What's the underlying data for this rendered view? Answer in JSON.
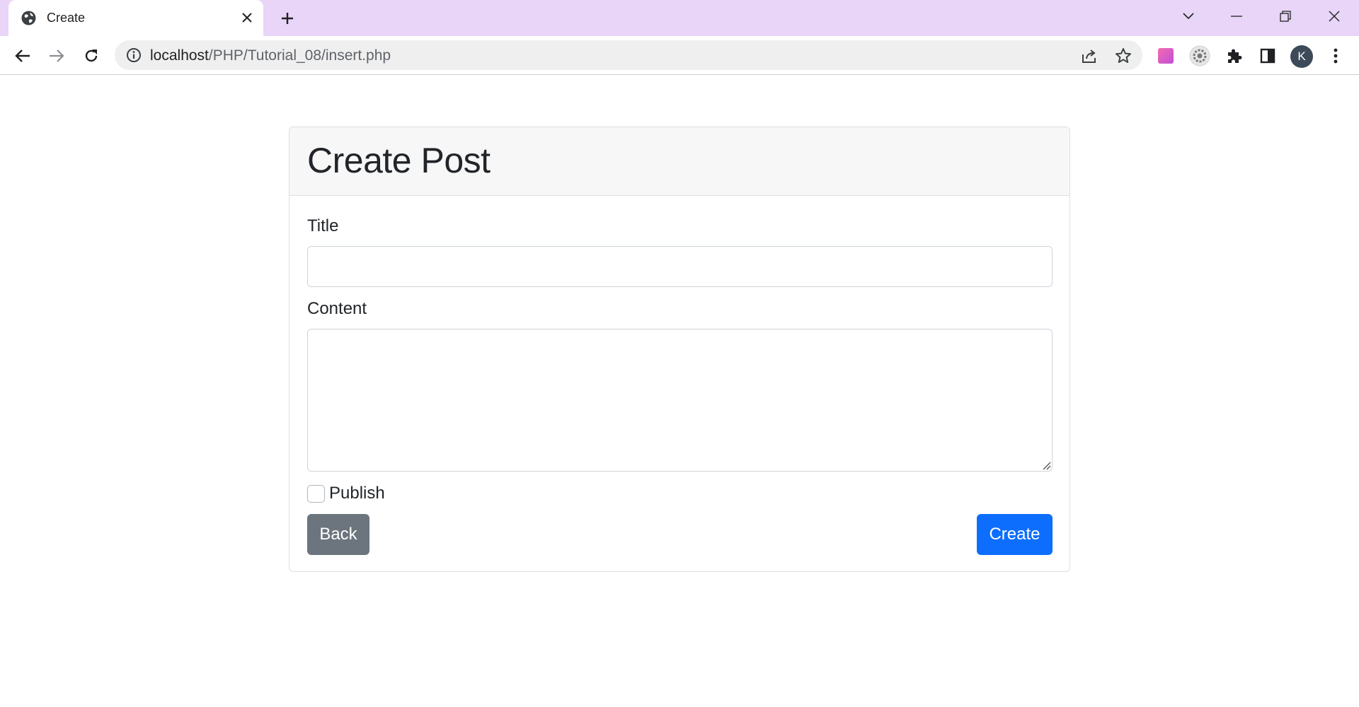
{
  "browser": {
    "tab_title": "Create",
    "url_host": "localhost",
    "url_path": "/PHP/Tutorial_08/insert.php",
    "profile_initial": "K",
    "icons": [
      "globe-icon",
      "close-icon",
      "plus-icon",
      "chevron-down-icon",
      "minimize-icon",
      "restore-icon",
      "window-close-icon",
      "back-arrow-icon",
      "forward-arrow-icon",
      "reload-icon",
      "info-icon",
      "share-icon",
      "star-icon",
      "extension-gradient-icon",
      "extension-gear-icon",
      "puzzle-icon",
      "sidepanel-icon",
      "kebab-menu-icon"
    ]
  },
  "page": {
    "heading": "Create Post",
    "title_label": "Title",
    "title_value": "",
    "content_label": "Content",
    "content_value": "",
    "publish_label": "Publish",
    "publish_checked": false,
    "back_button": "Back",
    "create_button": "Create"
  },
  "colors": {
    "tabstrip": "#e8d5f7",
    "primary": "#0d6efd",
    "secondary": "#6c757d"
  }
}
